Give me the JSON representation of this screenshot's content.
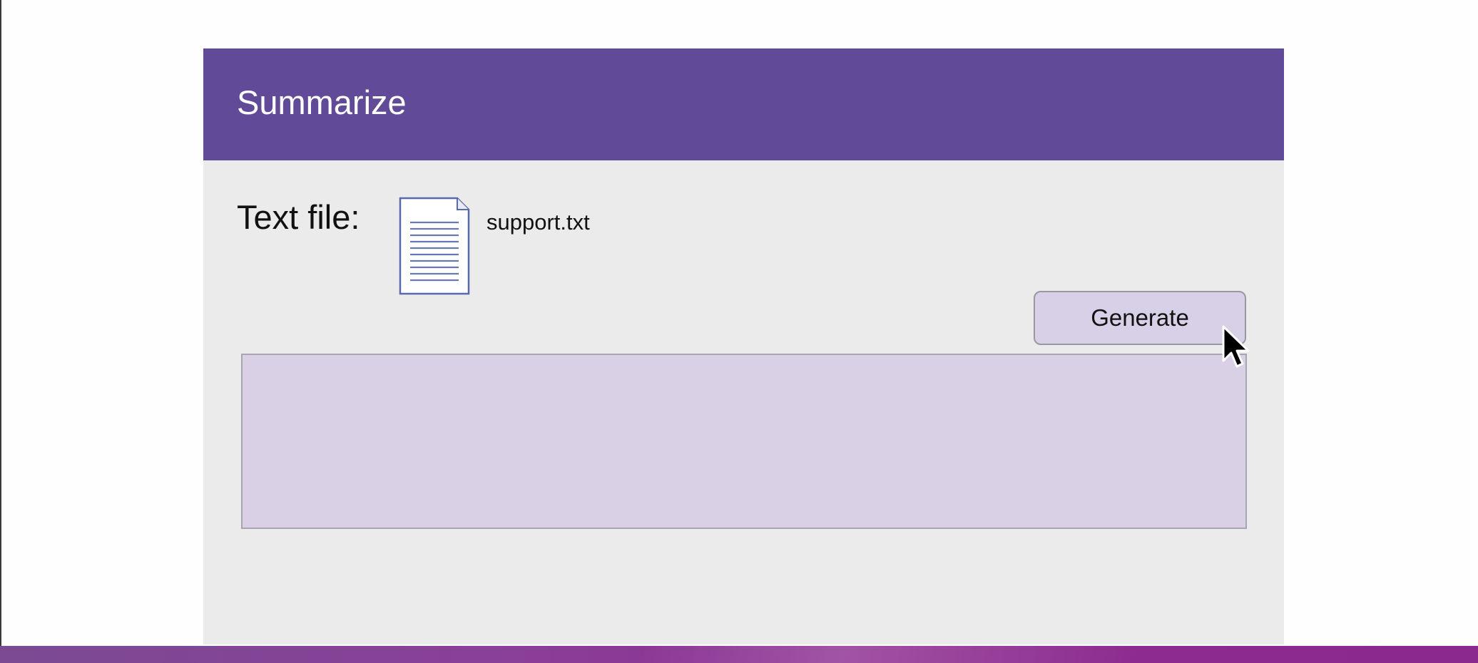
{
  "panel": {
    "title": "Summarize",
    "header_color": "#614b99",
    "background_color": "#ebebeb"
  },
  "file": {
    "label": "Text file:",
    "icon": "text-document-icon",
    "name": "support.txt"
  },
  "actions": {
    "generate_label": "Generate"
  },
  "output": {
    "value": "",
    "background_color": "#d9d0e6"
  },
  "pointer": {
    "icon": "mouse-pointer-icon"
  }
}
